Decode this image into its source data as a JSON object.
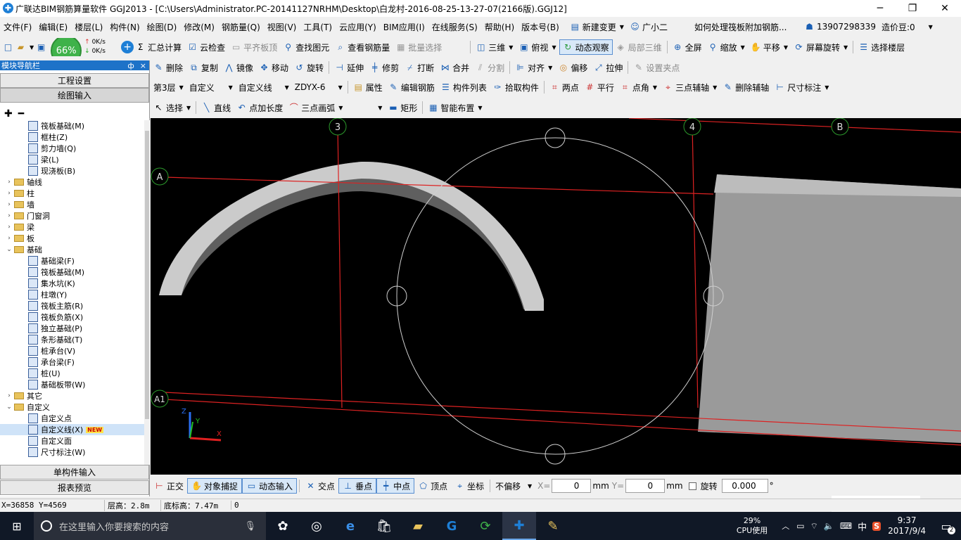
{
  "window": {
    "title": "广联达BIM钢筋算量软件 GGJ2013 - [C:\\Users\\Administrator.PC-20141127NRHM\\Desktop\\白龙村-2016-08-25-13-27-07(2166版).GGJ12]",
    "minimize": "─",
    "maximize": "❐",
    "close": "✕"
  },
  "menu": {
    "items": [
      "文件(F)",
      "编辑(E)",
      "楼层(L)",
      "构件(N)",
      "绘图(D)",
      "修改(M)",
      "钢筋量(Q)",
      "视图(V)",
      "工具(T)",
      "云应用(Y)",
      "BIM应用(I)",
      "在线服务(S)",
      "帮助(H)",
      "版本号(B)"
    ],
    "new_change": "新建变更",
    "guangxiaoer": "广小二",
    "question": "如何处理筏板附加钢筋...",
    "phone": "13907298339",
    "price": "造价豆:0"
  },
  "net_widget": {
    "percent": "66%",
    "up": "0K/s",
    "down": "0K/s"
  },
  "toolbar1": {
    "sum": "汇总计算",
    "cloud_check": "云检查",
    "align_top": "平齐板顶",
    "find": "查找图元",
    "view_rebar": "查看钢筋量",
    "batch_select": "批量选择",
    "three_d": "三维",
    "top_view": "俯视",
    "dynamic_view": "动态观察",
    "local_3d": "局部三维",
    "fullscreen": "全屏",
    "zoom": "缩放",
    "pan": "平移",
    "rotate_screen": "屏幕旋转",
    "select_floor": "选择楼层"
  },
  "nav": {
    "title": "模块导航栏",
    "pin": "ф",
    "close": "×",
    "project_settings": "工程设置",
    "drawing_input": "绘图输入",
    "single_input": "单构件输入",
    "report_preview": "报表预览",
    "tree": [
      {
        "indent": 2,
        "type": "comp",
        "label": "筏板基础(M)"
      },
      {
        "indent": 2,
        "type": "comp",
        "label": "框柱(Z)"
      },
      {
        "indent": 2,
        "type": "comp",
        "label": "剪力墙(Q)"
      },
      {
        "indent": 2,
        "type": "comp",
        "label": "梁(L)"
      },
      {
        "indent": 2,
        "type": "comp",
        "label": "现浇板(B)"
      },
      {
        "indent": 1,
        "type": "folder",
        "exp": ">",
        "label": "轴线"
      },
      {
        "indent": 1,
        "type": "folder",
        "exp": ">",
        "label": "柱"
      },
      {
        "indent": 1,
        "type": "folder",
        "exp": ">",
        "label": "墙"
      },
      {
        "indent": 1,
        "type": "folder",
        "exp": ">",
        "label": "门窗洞"
      },
      {
        "indent": 1,
        "type": "folder",
        "exp": ">",
        "label": "梁"
      },
      {
        "indent": 1,
        "type": "folder",
        "exp": ">",
        "label": "板"
      },
      {
        "indent": 1,
        "type": "folder",
        "exp": "v",
        "label": "基础"
      },
      {
        "indent": 2,
        "type": "comp",
        "label": "基础梁(F)"
      },
      {
        "indent": 2,
        "type": "comp",
        "label": "筏板基础(M)"
      },
      {
        "indent": 2,
        "type": "comp",
        "label": "集水坑(K)"
      },
      {
        "indent": 2,
        "type": "comp",
        "label": "柱墩(Y)"
      },
      {
        "indent": 2,
        "type": "comp",
        "label": "筏板主筋(R)"
      },
      {
        "indent": 2,
        "type": "comp",
        "label": "筏板负筋(X)"
      },
      {
        "indent": 2,
        "type": "comp",
        "label": "独立基础(P)"
      },
      {
        "indent": 2,
        "type": "comp",
        "label": "条形基础(T)"
      },
      {
        "indent": 2,
        "type": "comp",
        "label": "桩承台(V)"
      },
      {
        "indent": 2,
        "type": "comp",
        "label": "承台梁(F)"
      },
      {
        "indent": 2,
        "type": "comp",
        "label": "桩(U)"
      },
      {
        "indent": 2,
        "type": "comp",
        "label": "基础板带(W)"
      },
      {
        "indent": 1,
        "type": "folder",
        "exp": ">",
        "label": "其它"
      },
      {
        "indent": 1,
        "type": "folder",
        "exp": "v",
        "label": "自定义"
      },
      {
        "indent": 2,
        "type": "comp",
        "label": "自定义点"
      },
      {
        "indent": 2,
        "type": "comp",
        "label": "自定义线(X)",
        "badge": "NEW"
      },
      {
        "indent": 2,
        "type": "comp",
        "label": "自定义面"
      },
      {
        "indent": 2,
        "type": "comp",
        "label": "尺寸标注(W)"
      }
    ]
  },
  "toolbar2": {
    "delete": "删除",
    "copy": "复制",
    "mirror": "镜像",
    "move": "移动",
    "rotate": "旋转",
    "extend": "延伸",
    "trim": "修剪",
    "break": "打断",
    "merge": "合并",
    "split": "分割",
    "align": "对齐",
    "offset": "偏移",
    "stretch": "拉伸",
    "set_grip": "设置夹点"
  },
  "toolbar3": {
    "floor": "第3层",
    "custom": "自定义",
    "custom_line": "自定义线",
    "code": "ZDYX-6",
    "properties": "属性",
    "edit_rebar": "编辑钢筋",
    "comp_list": "构件列表",
    "pick": "拾取构件",
    "two_points": "两点",
    "parallel": "平行",
    "point_angle": "点角",
    "three_point_axis": "三点辅轴",
    "delete_axis": "删除辅轴",
    "dimension": "尺寸标注"
  },
  "toolbar4": {
    "select": "选择",
    "line": "直线",
    "point_len": "点加长度",
    "arc3": "三点画弧",
    "rect": "矩形",
    "smart": "智能布置"
  },
  "canvas": {
    "axes": [
      "3",
      "4",
      "B",
      "A",
      "A1"
    ],
    "coord_x": "X",
    "coord_y": "Y",
    "coord_z": "Z"
  },
  "snapbar": {
    "ortho": "正交",
    "obj_snap": "对象捕捉",
    "dyn_input": "动态输入",
    "intersect": "交点",
    "perp": "垂点",
    "mid": "中点",
    "vertex": "顶点",
    "coord": "坐标",
    "offset_mode": "不偏移",
    "x_label": "X=",
    "x_value": "0",
    "mm1": "mm",
    "y_label": "Y=",
    "y_value": "0",
    "mm2": "mm",
    "rotate": "旋转",
    "rotate_value": "0.000",
    "deg": "°"
  },
  "status": {
    "coords": "X=36858  Y=4569",
    "floor_height": "层高：2.8m",
    "base_height": "底标高：7.47m",
    "zero": "0"
  },
  "ime": {
    "label": "中"
  },
  "taskbar": {
    "search_placeholder": "在这里输入你要搜索的内容",
    "cpu_percent": "29%",
    "cpu_label": "CPU使用",
    "lang": "中",
    "time": "9:37",
    "date": "2017/9/4",
    "notif_count": "2"
  }
}
